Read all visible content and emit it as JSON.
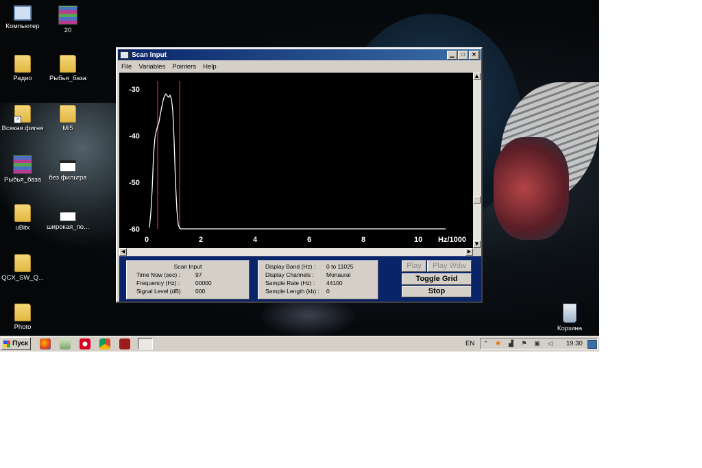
{
  "desktop_icons": [
    {
      "id": "computer",
      "label": "Компьютер",
      "icon": "computer-icon"
    },
    {
      "id": "20",
      "label": "20",
      "icon": "winrar-archive-icon"
    },
    {
      "id": "radio",
      "label": "Радио",
      "icon": "folder-icon"
    },
    {
      "id": "ryba1",
      "label": "Рыбья_база",
      "icon": "folder-icon"
    },
    {
      "id": "vsyakaya",
      "label": "Всякая фигня",
      "icon": "folder-shortcut-icon"
    },
    {
      "id": "mi5",
      "label": "Mi5",
      "icon": "folder-icon"
    },
    {
      "id": "ryba2",
      "label": "Рыбья_база",
      "icon": "winrar-archive-icon"
    },
    {
      "id": "bez",
      "label": "без фильтра",
      "icon": "program-icon"
    },
    {
      "id": "ubitx",
      "label": "uBitx",
      "icon": "folder-icon"
    },
    {
      "id": "shirokaya",
      "label": "широкая_по...",
      "icon": "program-icon"
    },
    {
      "id": "qcx",
      "label": "QCX_SW_Q...",
      "icon": "folder-icon"
    },
    {
      "id": "photo",
      "label": "Photo",
      "icon": "folder-icon"
    },
    {
      "id": "recycle",
      "label": "Корзина",
      "icon": "recycle-bin-icon"
    }
  ],
  "window": {
    "title": "Scan Input",
    "menu": [
      "File",
      "Variables",
      "Pointers",
      "Help"
    ],
    "plot": {
      "y_ticks": [
        "-30",
        "-40",
        "-50",
        "-60"
      ],
      "x_ticks": [
        "0",
        "2",
        "4",
        "6",
        "8",
        "10"
      ],
      "x_unit": "Hz/1000",
      "trace_color": "#ffffff",
      "marker_color": "#b22222"
    },
    "panel": {
      "status": {
        "heading": "Scan Input",
        "rows": [
          {
            "label": "Time Now (sec) :",
            "value": "97"
          },
          {
            "label": "Frequency (Hz) :",
            "value": "00000"
          },
          {
            "label": "Signal Level (dB)",
            "value": "000"
          }
        ]
      },
      "settings": {
        "rows": [
          {
            "label": "Display Band (Hz) :",
            "value": "0 to 11025"
          },
          {
            "label": "Display Channels :",
            "value": "Monaural"
          },
          {
            "label": "Sample Rate (Hz) :",
            "value": "44100"
          },
          {
            "label": "Sample Length (kb) :",
            "value": "0"
          }
        ]
      },
      "buttons": {
        "play": "Play",
        "play_wdw": "Play Wdw",
        "toggle_grid": "Toggle Grid",
        "stop": "Stop"
      }
    }
  },
  "taskbar": {
    "start_label": "Пуск",
    "language": "EN",
    "clock": "19:30"
  }
}
